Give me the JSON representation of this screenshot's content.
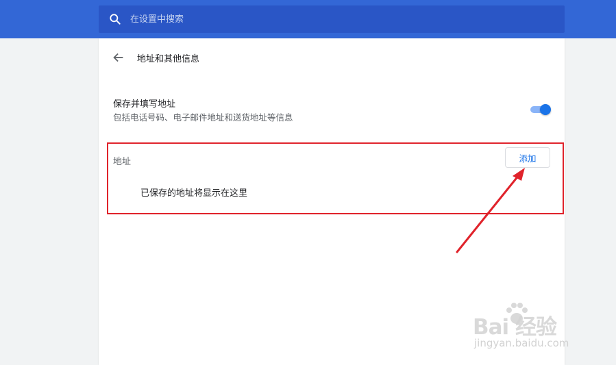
{
  "search": {
    "placeholder": "在设置中搜索",
    "value": ""
  },
  "page": {
    "title": "地址和其他信息"
  },
  "autofill_setting": {
    "title": "保存并填写地址",
    "subtitle": "包括电话号码、电子邮件地址和送货地址等信息",
    "enabled": true
  },
  "addresses": {
    "label": "地址",
    "add_label": "添加",
    "empty_message": "已保存的地址将显示在这里"
  },
  "watermark": {
    "logo": "Bai  经验",
    "url": "jingyan.baidu.com"
  },
  "colors": {
    "header": "#3367d6",
    "search_bg": "#2a56c6",
    "accent": "#1a73e8",
    "annotation_red": "#e0232b"
  },
  "icons": {
    "search": "search-icon",
    "back": "arrow-back-icon",
    "paw": "paw-icon"
  }
}
